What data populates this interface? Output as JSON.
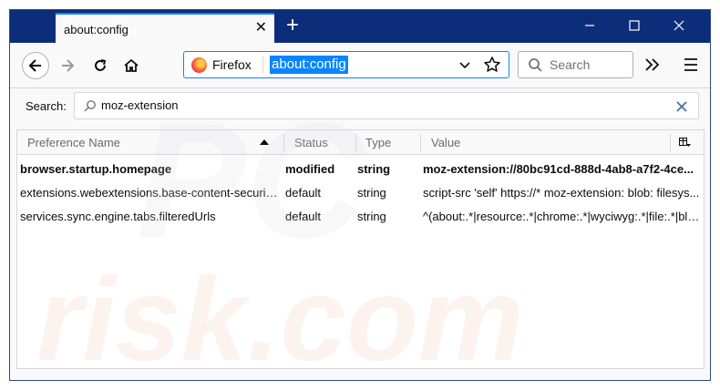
{
  "tab": {
    "title": "about:config",
    "close_glyph": "✕"
  },
  "toolbar": {
    "newtab_glyph": "+",
    "identity_label": "Firefox",
    "url": "about:config",
    "search_placeholder": "Search"
  },
  "config": {
    "search_label": "Search:",
    "filter_value": "moz-extension",
    "columns": [
      "Preference Name",
      "Status",
      "Type",
      "Value"
    ],
    "rows": [
      {
        "name": "browser.startup.homepage",
        "status": "modified",
        "type": "string",
        "value": "moz-extension://80bc91cd-888d-4ab8-a7f2-4ce...",
        "bold": true
      },
      {
        "name": "extensions.webextensions.base-content-security...",
        "status": "default",
        "type": "string",
        "value": "script-src 'self' https://* moz-extension: blob: filesys...",
        "bold": false
      },
      {
        "name": "services.sync.engine.tabs.filteredUrls",
        "status": "default",
        "type": "string",
        "value": "^(about:.*|resource:.*|chrome:.*|wyciwyg:.*|file:.*|blo...",
        "bold": false
      }
    ]
  },
  "colors": {
    "titlebar": "#0c2e7a",
    "accent": "#0a84ff"
  },
  "icons": [
    "back-arrow-icon",
    "forward-arrow-icon",
    "reload-icon",
    "home-icon",
    "firefox-logo-icon",
    "dropdown-chevron-icon",
    "bookmark-star-icon",
    "search-icon",
    "overflow-chevron-icon",
    "hamburger-menu-icon",
    "magnifier-icon",
    "clear-icon",
    "sort-arrow-icon",
    "column-picker-icon",
    "minimize-icon",
    "maximize-icon",
    "close-window-icon"
  ],
  "watermark": {
    "line1": "PC",
    "line2": "risk.com"
  }
}
